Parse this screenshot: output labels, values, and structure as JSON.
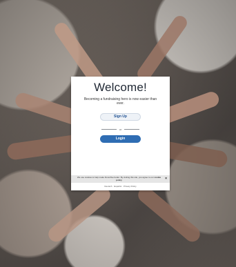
{
  "welcome": {
    "title": "Welcome!",
    "subtitle": "Becoming a fundraising hero is now easier than ever.",
    "signup_label": "Sign Up",
    "divider_text": "or",
    "login_label": "Login"
  },
  "cookie_banner": {
    "text": "We use cookies to help make Donorfive better. By visiting this site, you agree to our",
    "policy_link": "cookie policy",
    "close_glyph": "×"
  },
  "footer": {
    "links": [
      "Deutsch",
      "Español",
      "Privacy Policy"
    ]
  },
  "colors": {
    "login_bg": "#2f6db3",
    "signup_text": "#1d4f91",
    "title": "#1f2733"
  }
}
